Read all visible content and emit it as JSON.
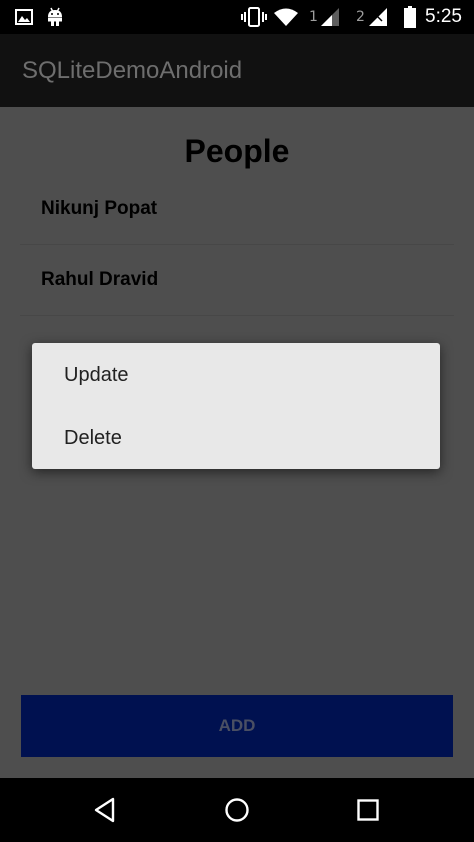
{
  "status_bar": {
    "time": "5:25",
    "sim1_label": "1",
    "sim2_label": "2",
    "icons": [
      "image-icon",
      "android-icon",
      "vibrate-icon",
      "wifi-icon",
      "signal-sim1-icon",
      "signal-sim2-icon",
      "battery-icon"
    ]
  },
  "app_bar": {
    "title": "SQLiteDemoAndroid"
  },
  "main": {
    "title": "People",
    "people": [
      {
        "name": "Nikunj Popat"
      },
      {
        "name": "Rahul Dravid"
      }
    ],
    "add_label": "ADD"
  },
  "context_menu": {
    "items": [
      {
        "label": "Update"
      },
      {
        "label": "Delete"
      }
    ]
  },
  "nav_bar": {
    "icons": [
      "back-icon",
      "home-icon",
      "recents-icon"
    ]
  },
  "colors": {
    "status_bar_bg": "#000000",
    "app_bar_bg": "#111111",
    "content_bg": "#4e4e4e",
    "menu_bg": "#e8e8e8",
    "add_button_bg": "#001150"
  }
}
